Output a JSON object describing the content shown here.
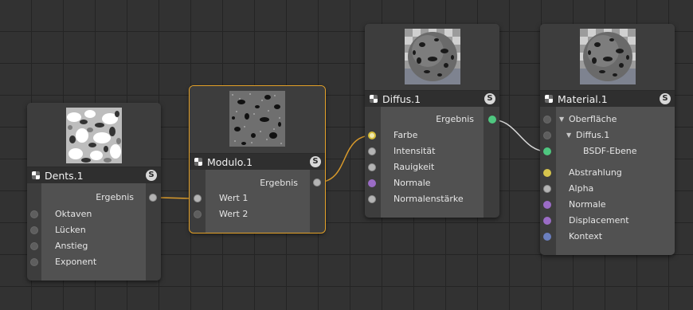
{
  "nodes": {
    "dents": {
      "title": "Dents.1",
      "badge": "S",
      "output": "Ergebnis",
      "inputs": [
        "Oktaven",
        "Lücken",
        "Anstieg",
        "Exponent"
      ]
    },
    "modulo": {
      "title": "Modulo.1",
      "badge": "S",
      "output": "Ergebnis",
      "inputs": [
        "Wert 1",
        "Wert 2"
      ]
    },
    "diffus": {
      "title": "Diffus.1",
      "badge": "S",
      "output": "Ergebnis",
      "inputs": [
        "Farbe",
        "Intensität",
        "Rauigkeit",
        "Normale",
        "Normalenstärke"
      ]
    },
    "material": {
      "title": "Material.1",
      "badge": "S",
      "tree": [
        "Oberfläche",
        "Diffus.1",
        "BSDF-Ebene"
      ],
      "inputs": [
        "Abstrahlung",
        "Alpha",
        "Normale",
        "Displacement",
        "Kontext"
      ]
    }
  },
  "colors": {
    "selection": "#e3a128",
    "wire_orange": "#d99a2b",
    "wire_white": "#d8d8d8",
    "port_green": "#4fc780",
    "port_yellow": "#d6c44d",
    "port_purple": "#9b6cc6",
    "port_blue": "#6b7fbf"
  }
}
